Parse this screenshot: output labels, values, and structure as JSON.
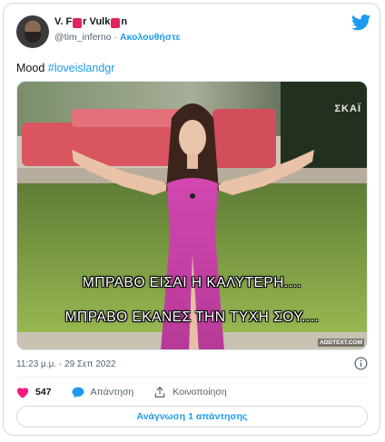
{
  "author": {
    "name_part1": "V. F",
    "name_part2": "r Vulk",
    "name_part3": "n",
    "handle": "@tim_inferno",
    "separator": "·",
    "follow_label": "Ακολουθήστε"
  },
  "tweet": {
    "text": "Mood ",
    "hashtag": "#loveislandgr"
  },
  "media": {
    "channel_watermark": "ΣΚΑΪ",
    "caption_line1": "ΜΠΡΑΒΟ ΕΙΣΑΙ Η ΚΑΛΥΤΕΡΗ....",
    "caption_line2": "ΜΠΡΑΒΟ ΕΚΑΝΕΣ ΤΗΝ ΤΥΧΗ ΣΟΥ....",
    "source_tag": "ADDTEXT.COM"
  },
  "meta": {
    "timestamp": "11:23 μ.μ. · 29 Σεπ 2022"
  },
  "actions": {
    "like_count": "547",
    "reply_label": "Απάντηση",
    "share_label": "Κοινοποίηση"
  },
  "read_replies_label": "Ανάγνωση 1 απάντησης",
  "colors": {
    "accent": "#1d9bf0",
    "like": "#f91880",
    "text": "#0f1419",
    "secondary": "#536471"
  },
  "icons": {
    "brand": "twitter-bird-icon",
    "info": "info-icon",
    "like": "heart-icon",
    "reply": "speech-bubble-icon",
    "share": "share-upload-icon"
  }
}
